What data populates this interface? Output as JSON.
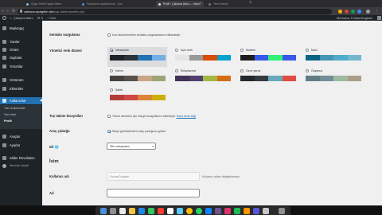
{
  "browser": {
    "tabs": [
      {
        "label": "Çilgin Sihirli Hayat Sitesi"
      },
      {
        "label": "Facebook sayfa kurma - Goo"
      },
      {
        "label": "Profil ‹ Çalışma Alanı — Word"
      },
      {
        "label": "Yeni Sekme"
      }
    ],
    "new_tab_symbol": "+",
    "url_host": "calisma.wpegitim.dev",
    "url_path": "/wp-admin/profile.php"
  },
  "admin_bar": {
    "site_name": "Çalışma Alanı",
    "comments_count": "0",
    "new_label": "+ Yeni",
    "greeting": "Merhaba, FurkanDogilam"
  },
  "sidebar": {
    "items": [
      {
        "label": "Başlangıç",
        "icon": "dashboard-icon"
      },
      {
        "label": "Yazılar",
        "icon": "pin-icon"
      },
      {
        "label": "Ortam",
        "icon": "media-icon"
      },
      {
        "label": "Sayfalar",
        "icon": "page-icon"
      },
      {
        "label": "Yorumlar",
        "icon": "comment-icon"
      },
      {
        "label": "Görünüm",
        "icon": "brush-icon"
      },
      {
        "label": "Eklentiler",
        "icon": "plugin-icon"
      },
      {
        "label": "Kullanıcılar",
        "icon": "users-icon"
      }
    ],
    "submenu": [
      "Tüm kullanıcılar",
      "Yeni ekle",
      "Profil"
    ],
    "items_after": [
      {
        "label": "Araçlar",
        "icon": "wrench-icon"
      },
      {
        "label": "Ayarlar",
        "icon": "settings-icon"
      },
      {
        "label": "Slider Revolution",
        "icon": "slider-icon"
      }
    ],
    "collapse_label": "Menüyü daralt"
  },
  "profile": {
    "visual_editor_label": "Sentaks vurgulama",
    "visual_editor_option": "Kod düzenlenirken sentaks vurgulamasını etkisizleştir",
    "color_scheme_label": "Yönetici renk düzeni",
    "schemes": [
      {
        "name": "Varsayılan",
        "colors": [
          "#1d2327",
          "#2c3338",
          "#2271b1",
          "#72aee6"
        ],
        "selected": true
      },
      {
        "name": "Açık renk",
        "colors": [
          "#e5e5e5",
          "#999999",
          "#d64e07",
          "#04a4cc"
        ],
        "selected": false
      },
      {
        "name": "Modern",
        "colors": [
          "#1e1e1e",
          "#3858e9",
          "#33f078",
          "#3858e9"
        ],
        "selected": false
      },
      {
        "name": "Mavi",
        "colors": [
          "#096484",
          "#4796b3",
          "#52accc",
          "#74b6ce"
        ],
        "selected": false
      },
      {
        "name": "Kahve",
        "colors": [
          "#46403c",
          "#59524c",
          "#c7a589",
          "#9ea476"
        ],
        "selected": false
      },
      {
        "name": "Ektoplazma",
        "colors": [
          "#413256",
          "#523f6d",
          "#a3b745",
          "#d46f15"
        ],
        "selected": false
      },
      {
        "name": "Gece yarısı",
        "colors": [
          "#25282b",
          "#363b3f",
          "#69a8bb",
          "#e14d43"
        ],
        "selected": false
      },
      {
        "name": "Okyanus",
        "colors": [
          "#627c83",
          "#738e96",
          "#9ebaa0",
          "#aa9d88"
        ],
        "selected": false
      },
      {
        "name": "Şafak",
        "colors": [
          "#b43c38",
          "#cf4944",
          "#dd823b",
          "#ccaf0b"
        ],
        "selected": false
      }
    ],
    "shortcuts_label": "Tuş takımı kısayolları",
    "shortcuts_option": "Yorum denetimi için klavye kısayollarını etkinleştir.",
    "shortcuts_link": "Daha fazla bilgi",
    "toolbar_label": "Araç çubuğu",
    "toolbar_option": "Siteyi görüntülerken araç çubuğunu göster",
    "language_label": "Dil",
    "language_value": "Site varsayılanı",
    "name_heading": "İsim",
    "username_label": "Kullanıcı adı",
    "username_value": "FurkanDogilam",
    "username_hint": "Kullanıcı adları değiştirilemez.",
    "firstname_label": "Ad",
    "firstname_value": ""
  },
  "colors": {
    "admin_dark": "#1d2327",
    "accent": "#2271b1",
    "content_bg": "#f0f0f1"
  }
}
